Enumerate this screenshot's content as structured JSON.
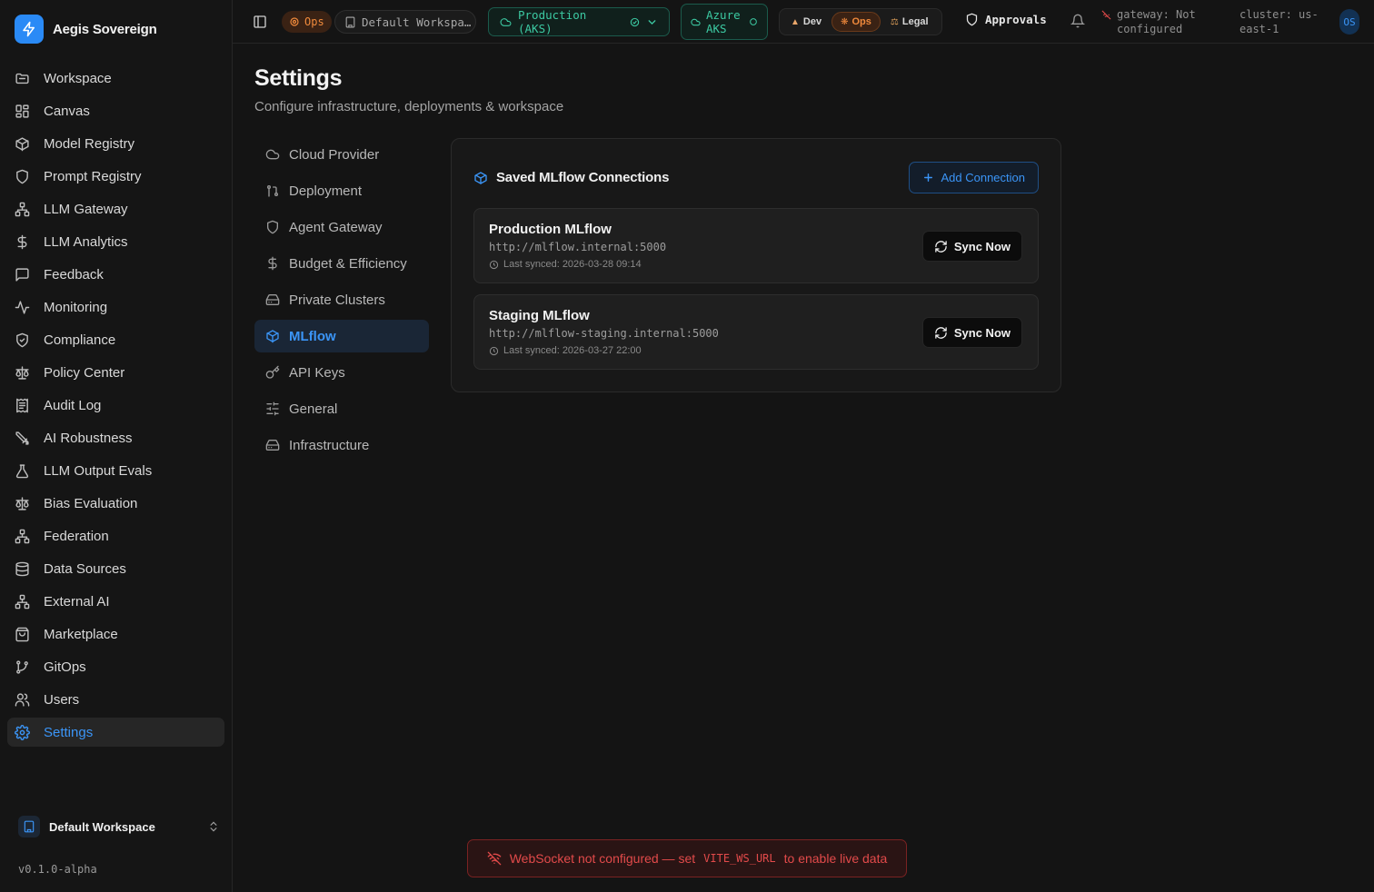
{
  "app": {
    "name": "Aegis Sovereign",
    "version": "v0.1.0-alpha",
    "workspace": "Default Workspace"
  },
  "sidebar": {
    "items": [
      {
        "label": "Workspace",
        "icon": "folder-icon"
      },
      {
        "label": "Canvas",
        "icon": "grid-icon"
      },
      {
        "label": "Model Registry",
        "icon": "cube-icon"
      },
      {
        "label": "Prompt Registry",
        "icon": "shield-icon"
      },
      {
        "label": "LLM Gateway",
        "icon": "network-icon"
      },
      {
        "label": "LLM Analytics",
        "icon": "dollar-icon"
      },
      {
        "label": "Feedback",
        "icon": "message-icon"
      },
      {
        "label": "Monitoring",
        "icon": "activity-icon"
      },
      {
        "label": "Compliance",
        "icon": "shield-check-icon"
      },
      {
        "label": "Policy Center",
        "icon": "scale-icon"
      },
      {
        "label": "Audit Log",
        "icon": "receipt-icon"
      },
      {
        "label": "AI Robustness",
        "icon": "swords-icon"
      },
      {
        "label": "LLM Output Evals",
        "icon": "flask-icon"
      },
      {
        "label": "Bias Evaluation",
        "icon": "scale-icon"
      },
      {
        "label": "Federation",
        "icon": "network-icon"
      },
      {
        "label": "Data Sources",
        "icon": "database-icon"
      },
      {
        "label": "External AI",
        "icon": "network-icon"
      },
      {
        "label": "Marketplace",
        "icon": "shopping-bag-icon"
      },
      {
        "label": "GitOps",
        "icon": "git-branch-icon"
      },
      {
        "label": "Users",
        "icon": "users-icon"
      },
      {
        "label": "Settings",
        "icon": "gear-icon"
      }
    ],
    "active_index": 20
  },
  "topbar": {
    "persona_badge": "Ops",
    "workspace_pill": "Default Workspa…",
    "environment": "Production (AKS)",
    "cloud_line1": "Azure",
    "cloud_line2": "AKS",
    "personas": [
      "Dev",
      "Ops",
      "Legal"
    ],
    "active_persona": "Ops",
    "approvals": "Approvals",
    "gateway_line1": "gateway: Not",
    "gateway_line2": "configured",
    "cluster_line1": "cluster: us-",
    "cluster_line2": "east-1",
    "avatar_initials": "OS"
  },
  "page": {
    "title": "Settings",
    "subtitle": "Configure infrastructure, deployments & workspace"
  },
  "settings_nav": {
    "items": [
      {
        "label": "Cloud Provider",
        "icon": "cloud-icon"
      },
      {
        "label": "Deployment",
        "icon": "git-pull-request-icon"
      },
      {
        "label": "Agent Gateway",
        "icon": "shield-icon"
      },
      {
        "label": "Budget & Efficiency",
        "icon": "dollar-icon"
      },
      {
        "label": "Private Clusters",
        "icon": "hard-drive-icon"
      },
      {
        "label": "MLflow",
        "icon": "cube-icon"
      },
      {
        "label": "API Keys",
        "icon": "key-icon"
      },
      {
        "label": "General",
        "icon": "sliders-icon"
      },
      {
        "label": "Infrastructure",
        "icon": "hard-drive-icon"
      }
    ],
    "active_index": 5
  },
  "mlflow": {
    "section_title": "Saved MLflow Connections",
    "add_button": "Add Connection",
    "connections": [
      {
        "name": "Production MLflow",
        "url": "http://mlflow.internal:5000",
        "last_synced": "Last synced: 2026-03-28 09:14",
        "action": "Sync Now"
      },
      {
        "name": "Staging MLflow",
        "url": "http://mlflow-staging.internal:5000",
        "last_synced": "Last synced: 2026-03-27 22:00",
        "action": "Sync Now"
      }
    ]
  },
  "banner": {
    "text_before": "WebSocket not configured — set",
    "code": "VITE_WS_URL",
    "text_after": "to enable live data"
  },
  "colors": {
    "accent": "#3b95f7",
    "ops": "#f08a3c",
    "env": "#3cc9a2",
    "error": "#e24a4a"
  }
}
